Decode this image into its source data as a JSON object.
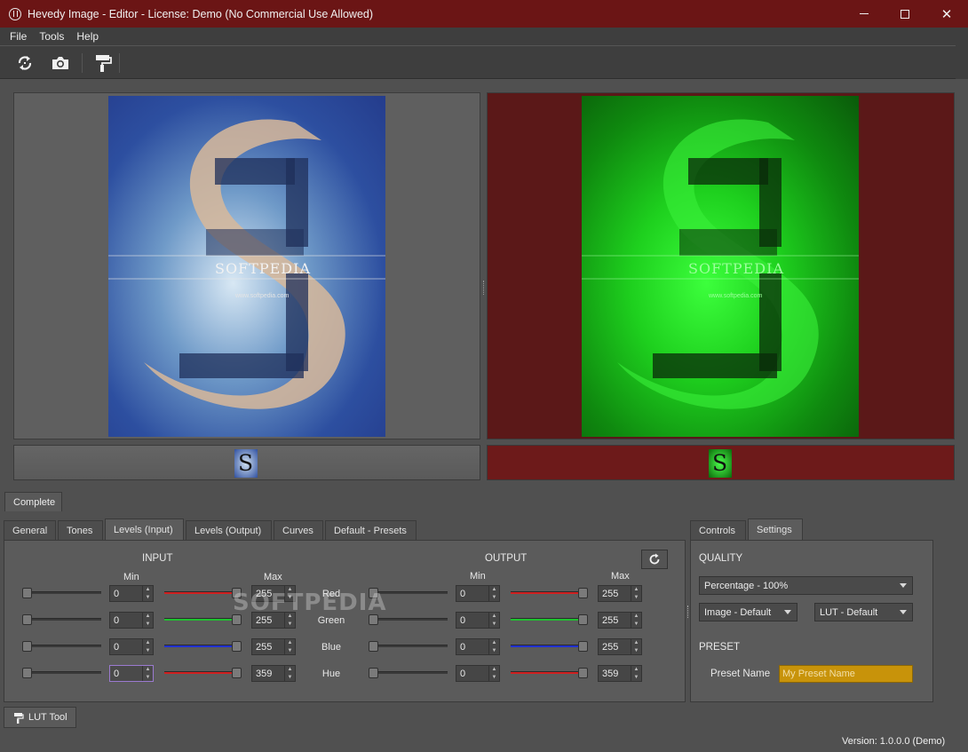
{
  "window": {
    "title": "Hevedy Image - Editor - License: Demo (No Commercial Use Allowed)",
    "minimize_label": "",
    "maximize_label": "",
    "close_label": "✕"
  },
  "menu": {
    "items": [
      "File",
      "Tools",
      "Help"
    ]
  },
  "toolbar": {
    "icons": [
      "refresh-icon",
      "camera-icon",
      "paint-roller-icon"
    ]
  },
  "viewer": {
    "left_watermark": "SOFTPEDIA",
    "left_url": "www.softpedia.com",
    "right_watermark": "SOFTPEDIA",
    "right_url": "www.softpedia.com",
    "thumb_letter": "S"
  },
  "colors": {
    "accent_dark_red": "#6b1515",
    "output_bg": "#5b1818",
    "preset_field": "#c8930a"
  },
  "section_tab": "Complete",
  "sub_tabs": [
    "General",
    "Tones",
    "Levels (Input)",
    "Levels (Output)",
    "Curves",
    "Default - Presets"
  ],
  "active_sub_tab": "Levels (Input)",
  "levels": {
    "input_header": "INPUT",
    "output_header": "OUTPUT",
    "min_label": "Min",
    "max_label": "Max",
    "rows": [
      {
        "label": "Red",
        "in_min": "0",
        "in_max": "255",
        "out_min": "0",
        "out_max": "255"
      },
      {
        "label": "Green",
        "in_min": "0",
        "in_max": "255",
        "out_min": "0",
        "out_max": "255"
      },
      {
        "label": "Blue",
        "in_min": "0",
        "in_max": "255",
        "out_min": "0",
        "out_max": "255"
      },
      {
        "label": "Hue",
        "in_min": "0",
        "in_max": "359",
        "out_min": "0",
        "out_max": "359"
      }
    ]
  },
  "settings_tabs": [
    "Controls",
    "Settings"
  ],
  "active_settings_tab": "Settings",
  "settings": {
    "quality_header": "QUALITY",
    "quality_value": "Percentage - 100%",
    "image_value": "Image - Default",
    "lut_value": "LUT - Default",
    "preset_header": "PRESET",
    "preset_name_label": "Preset Name",
    "preset_name_placeholder": "My Preset Name"
  },
  "lut_tool": "LUT Tool",
  "watermark": "SOFTPEDIA",
  "version": "Version: 1.0.0.0 (Demo)"
}
